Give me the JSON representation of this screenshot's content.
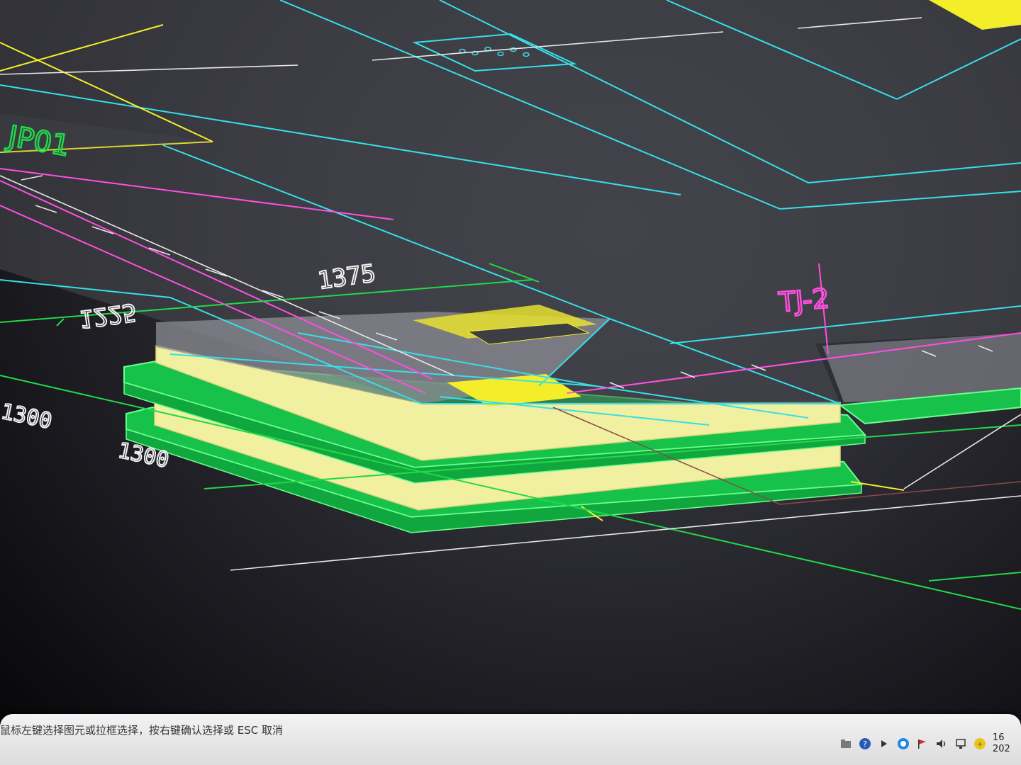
{
  "drawing": {
    "dimensions": {
      "d1": "1225",
      "d2": "1375",
      "d3": "1300",
      "d4": "1300"
    },
    "tags": {
      "slab_tag": "JP01",
      "column_tag": "TJ-2"
    }
  },
  "status_bar": {
    "prompt": "鼠标左键选择图元或拉框选择，按右键确认选择或 ESC 取消"
  },
  "tray": {
    "clock_time": "16",
    "clock_date": "202"
  },
  "colors": {
    "cyan": "#35e0e8",
    "green": "#22d84a",
    "magenta": "#ff4fe0",
    "yellow": "#f4ee2a",
    "pale_yellow": "#f1efa0"
  }
}
